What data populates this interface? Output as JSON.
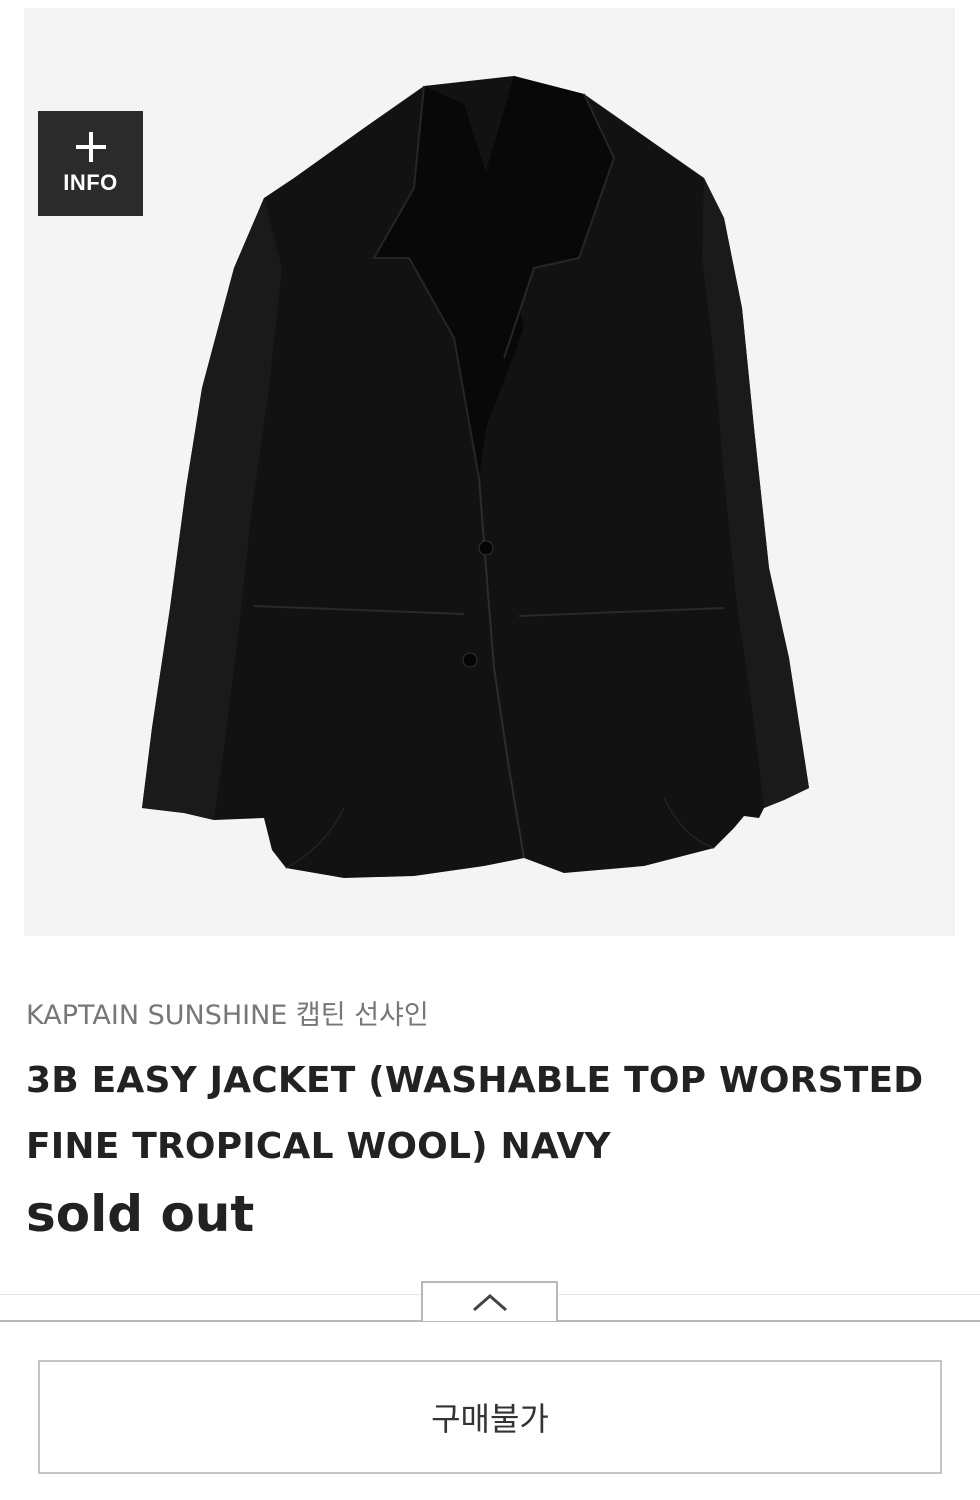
{
  "product": {
    "info_button_label": "INFO",
    "brand": "KAPTAIN SUNSHINE 캡틴 선샤인",
    "title": "3B EASY JACKET (WASHABLE TOP WORSTED FINE TROPICAL WOOL) NAVY",
    "price_status": "sold out"
  },
  "actions": {
    "purchase_label": "구매불가"
  },
  "icons": {
    "info": "plus-icon",
    "collapse": "chevron-up-icon"
  },
  "colors": {
    "photo_background": "#f4f4f4",
    "jacket": "#111111",
    "info_button": "#2b2b2b",
    "brand_text": "#777777",
    "title_text": "#222222"
  }
}
